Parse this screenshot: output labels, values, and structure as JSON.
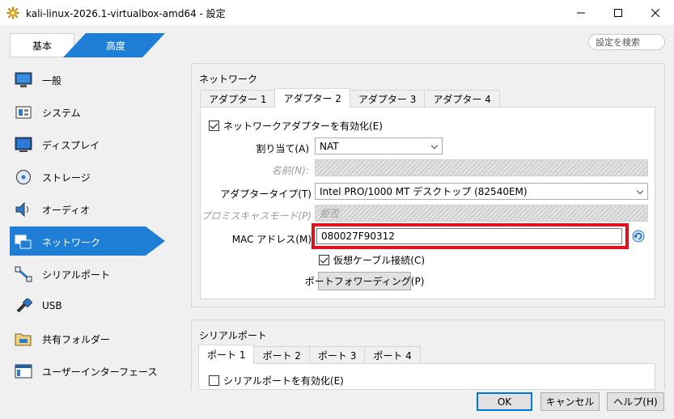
{
  "window": {
    "title": "kali-linux-2026.1-virtualbox-amd64 - 設定",
    "minimize_symbol": "—",
    "maximize_symbol": "☐",
    "close_symbol": "✕"
  },
  "mode": {
    "basic_label": "基本",
    "expert_label": "高度",
    "selected": "expert"
  },
  "search": {
    "placeholder": "設定を検索"
  },
  "sidebar": {
    "items": [
      {
        "label": "一般",
        "icon": "general-icon"
      },
      {
        "label": "システム",
        "icon": "system-icon"
      },
      {
        "label": "ディスプレイ",
        "icon": "display-icon"
      },
      {
        "label": "ストレージ",
        "icon": "storage-icon"
      },
      {
        "label": "オーディオ",
        "icon": "audio-icon"
      },
      {
        "label": "ネットワーク",
        "icon": "network-icon",
        "selected": true
      },
      {
        "label": "シリアルポート",
        "icon": "serial-port-icon"
      },
      {
        "label": "USB",
        "icon": "usb-icon"
      },
      {
        "label": "共有フォルダー",
        "icon": "shared-folder-icon"
      },
      {
        "label": "ユーザーインターフェース",
        "icon": "user-interface-icon"
      }
    ]
  },
  "network": {
    "title": "ネットワーク",
    "tabs": [
      "アダプター 1",
      "アダプター 2",
      "アダプター 3",
      "アダプター 4"
    ],
    "active_tab": "アダプター 2",
    "enable_label": "ネットワークアダプターを有効化(E)",
    "enable_checked": true,
    "attached_label": "割り当て(A)",
    "attached_value": "NAT",
    "name_label": "名前(N):",
    "adapter_type_label": "アダプタータイプ(T)",
    "adapter_type_value": "Intel PRO/1000 MT デスクトップ (82540EM)",
    "promisc_label": "プロミスキャスモード(P)",
    "promisc_value": "拒否",
    "mac_label": "MAC アドレス(M)",
    "mac_value": "080027F90312",
    "cable_label": "仮想ケーブル接続(C)",
    "cable_checked": true,
    "port_forwarding_label": "ポートフォワーディング(P)"
  },
  "serial": {
    "title": "シリアルポート",
    "tabs": [
      "ポート 1",
      "ポート 2",
      "ポート 3",
      "ポート 4"
    ],
    "active_tab": "ポート 1",
    "enable_label": "シリアルポートを有効化(E)",
    "enable_checked": false
  },
  "buttons": {
    "ok": "OK",
    "cancel": "キャンセル",
    "help": "ヘルプ(H)"
  },
  "colors": {
    "accent": "#1f7ed6",
    "highlight": "#e0101d"
  }
}
